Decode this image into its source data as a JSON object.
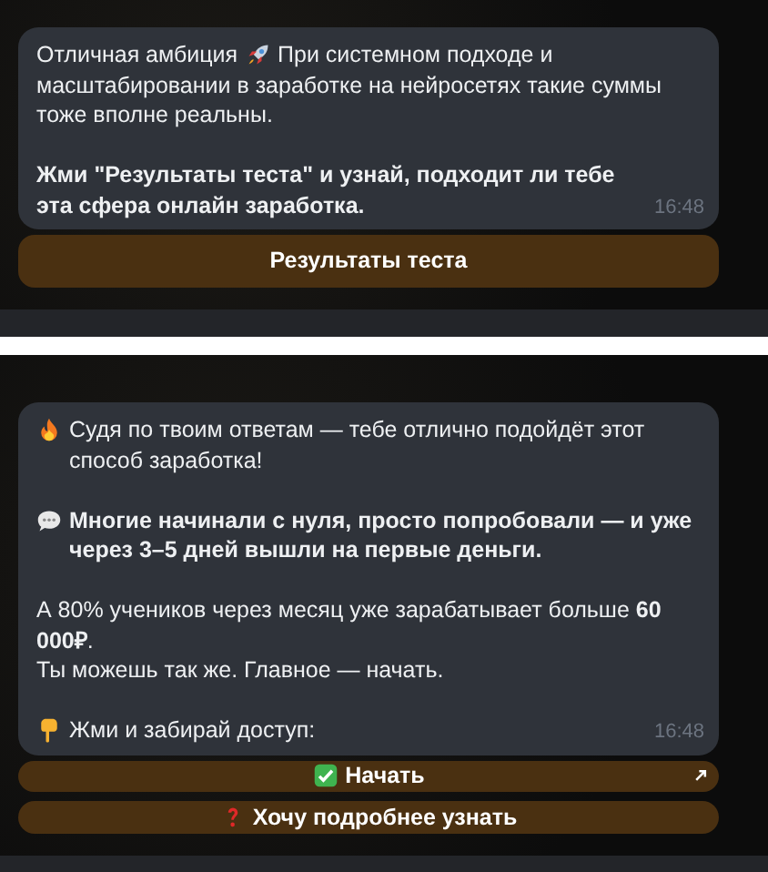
{
  "chats": [
    {
      "message": {
        "paragraphs": [
          {
            "lead": "Отличная амбиция",
            "text": "При системном подходе и",
            "continuation": "масштабировании в заработке на нейросетях такие суммы тоже вполне реальны.",
            "bold": false
          },
          {
            "text": "Жми \"Результаты теста\" и узнай, подходит ли тебе эта сфера онлайн заработка.",
            "bold": true
          }
        ],
        "time": "16:48"
      },
      "buttons": [
        {
          "label": "Результаты теста",
          "external": false
        }
      ]
    },
    {
      "message": {
        "paragraphs": [
          {
            "text": "Судя по твоим ответам — тебе отлично подойдёт этот способ заработка!",
            "bold": false
          },
          {
            "text": "Многие начинали с нуля, просто попробовали — и уже через 3–5 дней вышли на первые деньги.",
            "bold": true
          },
          {
            "text": "А 80% учеников через месяц уже зарабатывает больше **60 000₽**.\nТы можешь так же. Главное — начать.",
            "bold": false
          },
          {
            "text": "Жми и забирай доступ:",
            "bold": false
          }
        ],
        "time": "16:48"
      },
      "buttons": [
        {
          "label": "Начать",
          "external": true
        },
        {
          "label": "Хочу подробнее узнать",
          "external": false
        }
      ]
    }
  ]
}
